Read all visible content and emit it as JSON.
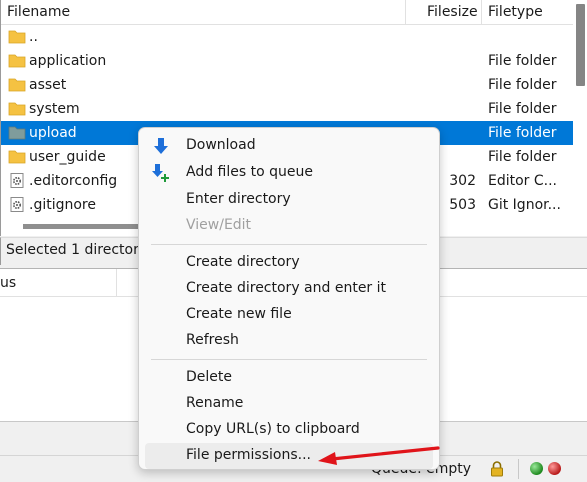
{
  "file_list": {
    "columns": {
      "filename": "Filename",
      "filesize": "Filesize",
      "filetype": "Filetype"
    },
    "rows": [
      {
        "name": "..",
        "size": "",
        "type": "",
        "icon": "folder-icon"
      },
      {
        "name": "application",
        "size": "",
        "type": "File folder",
        "icon": "folder-icon"
      },
      {
        "name": "asset",
        "size": "",
        "type": "File folder",
        "icon": "folder-icon"
      },
      {
        "name": "system",
        "size": "",
        "type": "File folder",
        "icon": "folder-icon"
      },
      {
        "name": "upload",
        "size": "",
        "type": "File folder",
        "icon": "folder-icon",
        "selected": true
      },
      {
        "name": "user_guide",
        "size": "",
        "type": "File folder",
        "icon": "folder-icon"
      },
      {
        "name": ".editorconfig",
        "size": "302",
        "type": "Editor C...",
        "icon": "gear-file-icon"
      },
      {
        "name": ".gitignore",
        "size": "503",
        "type": "Git Ignor...",
        "icon": "gear-file-icon"
      }
    ],
    "status": "Selected 1 directory."
  },
  "queue": {
    "column_fragment": "us",
    "status": "Queue: empty"
  },
  "context_menu": {
    "items": [
      {
        "label": "Download",
        "icon": "download-arrow-icon",
        "disabled": false
      },
      {
        "label": "Add files to queue",
        "icon": "add-to-queue-icon",
        "disabled": false
      },
      {
        "label": "Enter directory",
        "disabled": false
      },
      {
        "label": "View/Edit",
        "disabled": true
      },
      {
        "label": "Create directory",
        "disabled": false
      },
      {
        "label": "Create directory and enter it",
        "disabled": false
      },
      {
        "label": "Create new file",
        "disabled": false
      },
      {
        "label": "Refresh",
        "disabled": false
      },
      {
        "label": "Delete",
        "disabled": false
      },
      {
        "label": "Rename",
        "disabled": false
      },
      {
        "label": "Copy URL(s) to clipboard",
        "disabled": false
      },
      {
        "label": "File permissions...",
        "disabled": false,
        "highlighted": true
      }
    ]
  },
  "colors": {
    "selection": "#0078d7",
    "menu_background": "#f9f9f9",
    "annotation_arrow": "#e0141a",
    "folder": "#f5c242"
  }
}
